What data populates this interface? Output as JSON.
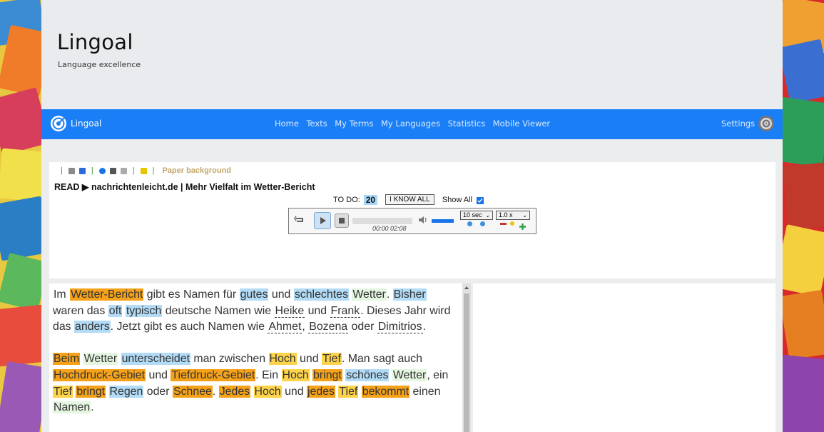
{
  "header": {
    "brand": "Lingoal",
    "tagline": "Language excellence"
  },
  "nav": {
    "brand": "Lingoal",
    "links": [
      "Home",
      "Texts",
      "My Terms",
      "My Languages",
      "Statistics",
      "Mobile Viewer"
    ],
    "settings": "Settings"
  },
  "reader": {
    "toolbar_label": "Paper background",
    "read_line": "READ ▶ nachrichtenleicht.de | Mehr Vielfalt im Wetter-Bericht",
    "todo_label": "TO DO:",
    "todo_count": "20",
    "iknow_label": "I KNOW ALL",
    "show_all_label": "Show All",
    "show_all_checked": true
  },
  "player": {
    "time": "00:00 02:08",
    "skip_option": "10 sec",
    "speed_option": "1.0 x"
  },
  "text": {
    "paragraphs": [
      [
        {
          "t": "Im",
          "s": ""
        },
        {
          "t": " "
        },
        {
          "t": "Wetter-Bericht",
          "s": "o"
        },
        {
          "t": " gibt es Namen für "
        },
        {
          "t": "gutes",
          "s": "b"
        },
        {
          "t": " und "
        },
        {
          "t": "schlechtes",
          "s": "b"
        },
        {
          "t": " "
        },
        {
          "t": "Wetter",
          "s": "g"
        },
        {
          "t": ". "
        },
        {
          "t": "Bisher",
          "s": "b"
        },
        {
          "t": " waren das "
        },
        {
          "t": "oft",
          "s": "b"
        },
        {
          "t": " "
        },
        {
          "t": "typisch",
          "s": "b"
        },
        {
          "t": " deutsche Namen wie "
        },
        {
          "t": "Heike",
          "s": "u"
        },
        {
          "t": " und "
        },
        {
          "t": "Frank",
          "s": "u"
        },
        {
          "t": ". Dieses Jahr wird das "
        },
        {
          "t": "anders",
          "s": "b"
        },
        {
          "t": ". Jetzt gibt es auch Namen wie "
        },
        {
          "t": "Ahmet",
          "s": "u"
        },
        {
          "t": ", "
        },
        {
          "t": "Bozena",
          "s": "u"
        },
        {
          "t": " oder "
        },
        {
          "t": "Dimitrios",
          "s": "u"
        },
        {
          "t": "."
        }
      ],
      [
        {
          "t": "Beim",
          "s": "o"
        },
        {
          "t": " "
        },
        {
          "t": "Wetter",
          "s": "g"
        },
        {
          "t": " "
        },
        {
          "t": "unterscheidet",
          "s": "b"
        },
        {
          "t": " man zwischen "
        },
        {
          "t": "Hoch",
          "s": "y"
        },
        {
          "t": " und "
        },
        {
          "t": "Tief",
          "s": "y"
        },
        {
          "t": ". Man sagt auch "
        },
        {
          "t": "Hochdruck-Gebiet",
          "s": "o"
        },
        {
          "t": " und "
        },
        {
          "t": "Tiefdruck-Gebiet",
          "s": "o"
        },
        {
          "t": ". Ein "
        },
        {
          "t": "Hoch",
          "s": "y"
        },
        {
          "t": " "
        },
        {
          "t": "bringt",
          "s": "o"
        },
        {
          "t": " "
        },
        {
          "t": "schönes",
          "s": "b"
        },
        {
          "t": " "
        },
        {
          "t": "Wetter",
          "s": "g"
        },
        {
          "t": ", ein "
        },
        {
          "t": "Tief",
          "s": "y"
        },
        {
          "t": " "
        },
        {
          "t": "bringt",
          "s": "o"
        },
        {
          "t": " "
        },
        {
          "t": "Regen",
          "s": "b"
        },
        {
          "t": " oder "
        },
        {
          "t": "Schnee",
          "s": "o"
        },
        {
          "t": ". "
        },
        {
          "t": "Jedes",
          "s": "o"
        },
        {
          "t": " "
        },
        {
          "t": "Hoch",
          "s": "y"
        },
        {
          "t": " und "
        },
        {
          "t": "jedes",
          "s": "o"
        },
        {
          "t": " "
        },
        {
          "t": "Tief",
          "s": "y"
        },
        {
          "t": " "
        },
        {
          "t": "bekommt",
          "s": "o"
        },
        {
          "t": " einen "
        },
        {
          "t": "Namen",
          "s": "g"
        },
        {
          "t": "."
        }
      ]
    ]
  },
  "colors": {
    "nav": "#1a7ff6",
    "orange": "#f5a21a",
    "yellow": "#fcd34a",
    "blue": "#b2dbf6",
    "green": "#e4f6e0"
  }
}
